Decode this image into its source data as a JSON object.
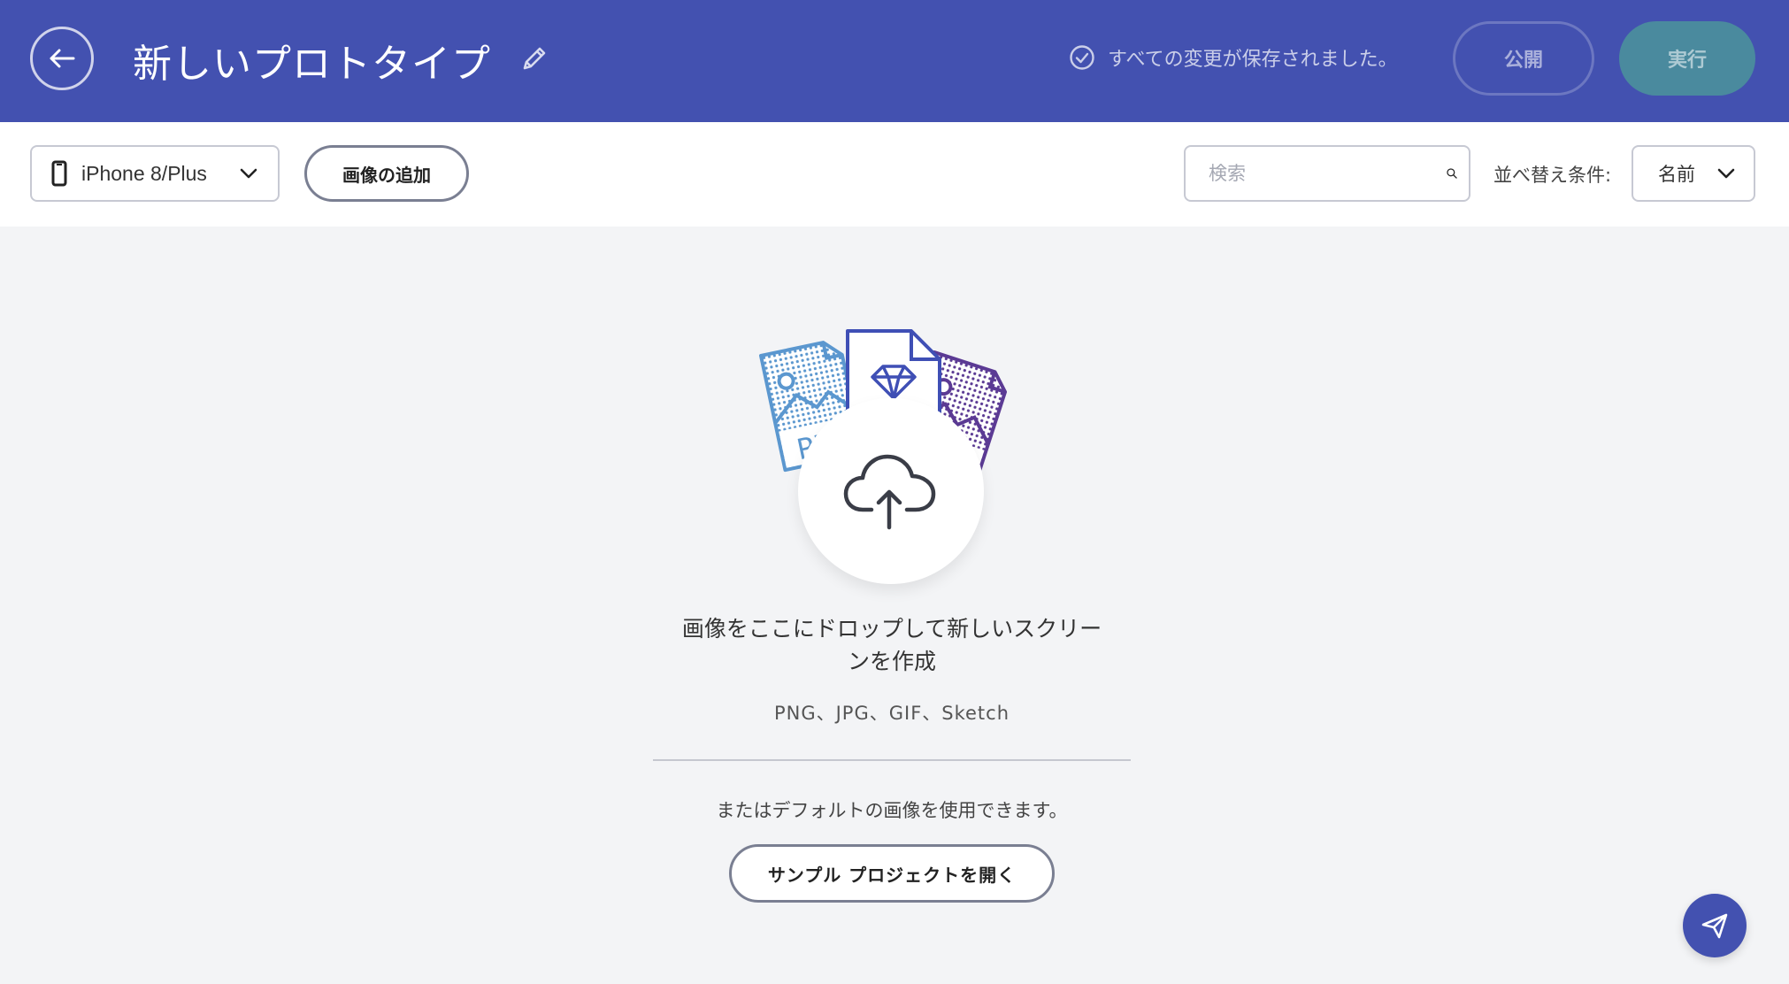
{
  "header": {
    "title": "新しいプロトタイプ",
    "save_status": "すべての変更が保存されました。",
    "publish_label": "公開",
    "run_label": "実行",
    "icons": [
      "back-arrow-icon",
      "pencil-icon",
      "check-circle-icon"
    ]
  },
  "toolbar": {
    "device_label": "iPhone 8/Plus",
    "add_image_label": "画像の追加",
    "search_placeholder": "検索",
    "search_value": "",
    "sort_label": "並べ替え条件:",
    "sort_value": "名前"
  },
  "dropzone": {
    "drop_text": "画像をここにドロップして新しいスクリーンを作成",
    "formats": "PNG、JPG、GIF、Sketch",
    "default_text": "またはデフォルトの画像を使用できます。",
    "sample_button_label": "サンプル プロジェクトを開く"
  },
  "colors": {
    "header_bg": "#4351b0",
    "run_button_bg": "#4a8a9e",
    "png_file": "#5b97cf",
    "sketch_file": "#3f4fb5",
    "gif_file": "#5b3a94"
  }
}
